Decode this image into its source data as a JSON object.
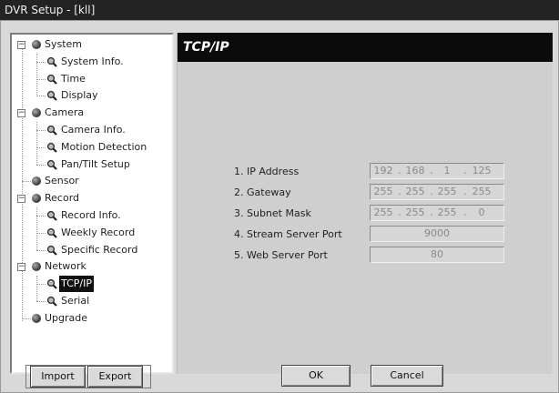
{
  "window": {
    "title": "DVR Setup - [kll]"
  },
  "tree": {
    "items": [
      {
        "label": "System",
        "level": 0,
        "expander": "minus",
        "icon": "gear-icon"
      },
      {
        "label": "System Info.",
        "level": 1,
        "icon": "magnifier-icon"
      },
      {
        "label": "Time",
        "level": 1,
        "icon": "magnifier-icon"
      },
      {
        "label": "Display",
        "level": 1,
        "icon": "magnifier-icon"
      },
      {
        "label": "Camera",
        "level": 0,
        "expander": "minus",
        "icon": "gear-icon"
      },
      {
        "label": "Camera Info.",
        "level": 1,
        "icon": "magnifier-icon"
      },
      {
        "label": "Motion Detection",
        "level": 1,
        "icon": "magnifier-icon"
      },
      {
        "label": "Pan/Tilt Setup",
        "level": 1,
        "icon": "magnifier-icon"
      },
      {
        "label": "Sensor",
        "level": 0,
        "icon": "gear-icon"
      },
      {
        "label": "Record",
        "level": 0,
        "expander": "minus",
        "icon": "gear-icon"
      },
      {
        "label": "Record Info.",
        "level": 1,
        "icon": "magnifier-icon"
      },
      {
        "label": "Weekly Record",
        "level": 1,
        "icon": "magnifier-icon"
      },
      {
        "label": "Specific Record",
        "level": 1,
        "icon": "magnifier-icon"
      },
      {
        "label": "Network",
        "level": 0,
        "expander": "minus",
        "icon": "gear-icon"
      },
      {
        "label": "TCP/IP",
        "level": 1,
        "icon": "magnifier-icon",
        "selected": true
      },
      {
        "label": "Serial",
        "level": 1,
        "icon": "magnifier-icon"
      },
      {
        "label": "Upgrade",
        "level": 0,
        "icon": "gear-icon"
      }
    ]
  },
  "panel": {
    "title": "TCP/IP",
    "rows": [
      {
        "label": "1. IP Address",
        "kind": "ip",
        "octets": [
          "192",
          "168",
          "1",
          "125"
        ]
      },
      {
        "label": "2. Gateway",
        "kind": "ip",
        "octets": [
          "255",
          "255",
          "255",
          "255"
        ]
      },
      {
        "label": "3. Subnet Mask",
        "kind": "ip",
        "octets": [
          "255",
          "255",
          "255",
          "0"
        ]
      },
      {
        "label": "4. Stream Server Port",
        "kind": "port",
        "value": "9000"
      },
      {
        "label": "5. Web Server Port",
        "kind": "port",
        "value": "80"
      }
    ],
    "ip_separator": "."
  },
  "buttons": {
    "import": "Import",
    "export": "Export",
    "ok": "OK",
    "cancel": "Cancel"
  },
  "colors": {
    "titlebar": "#232323",
    "header": "#0b0b0b",
    "selection": "#111111"
  }
}
